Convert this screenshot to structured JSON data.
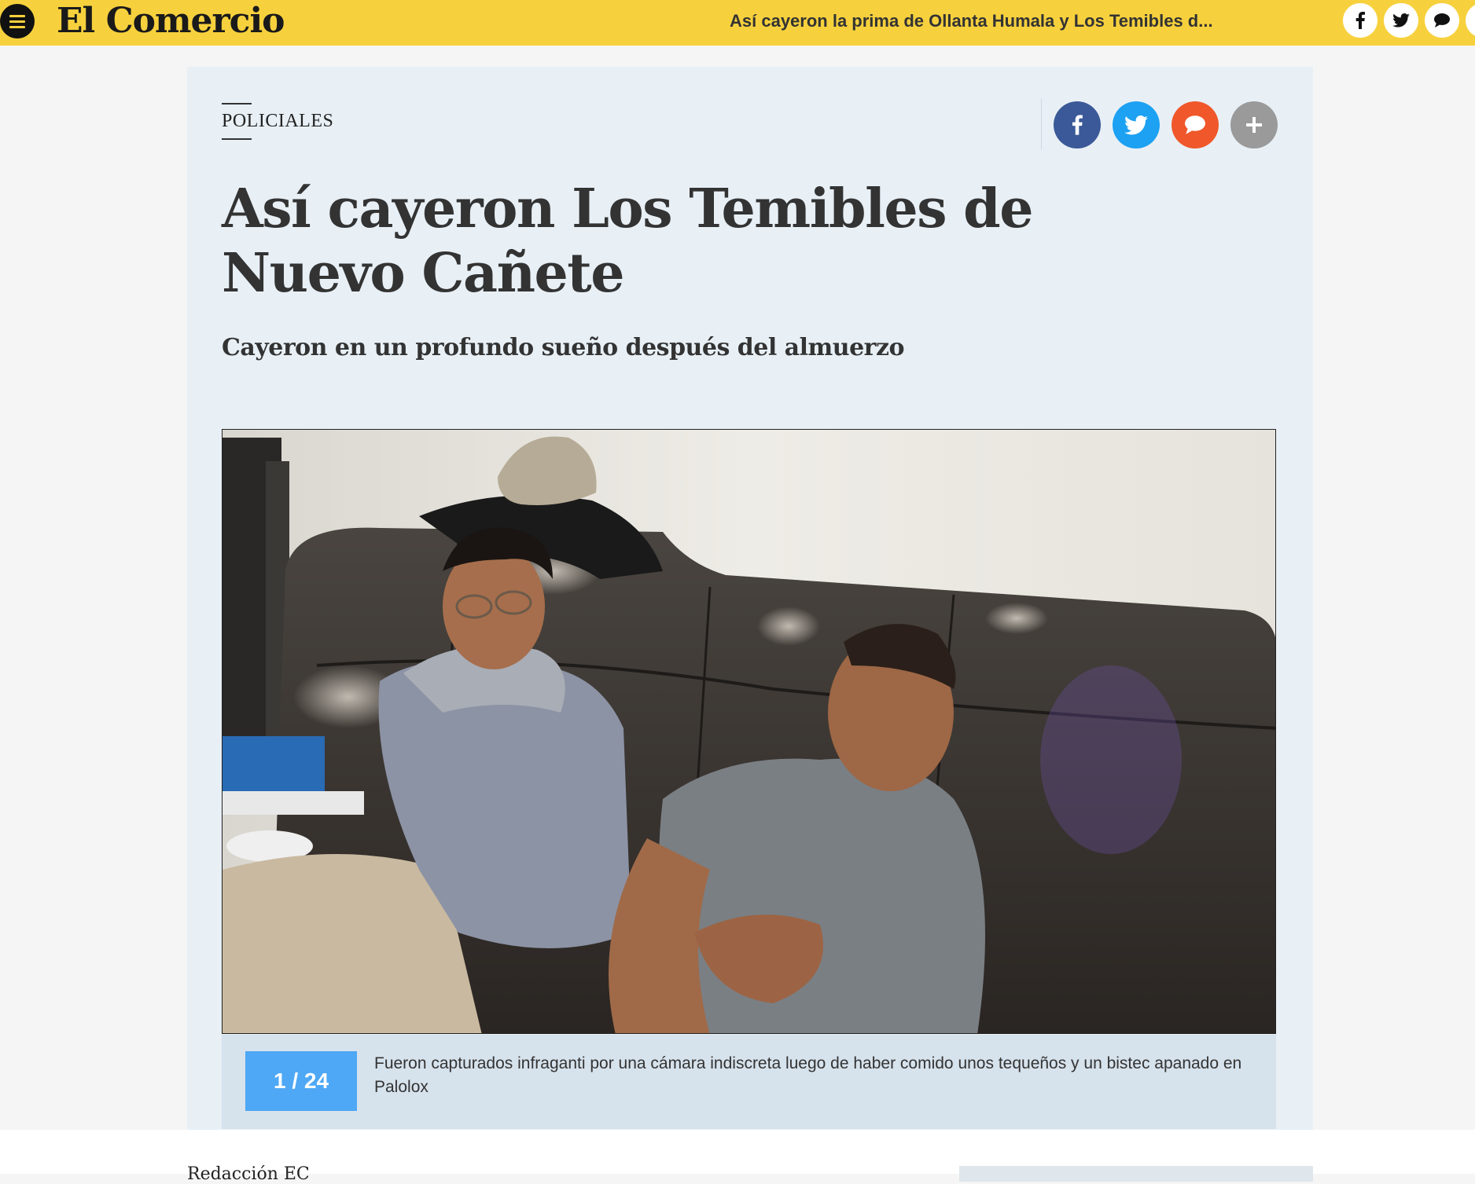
{
  "topbar": {
    "logo": "El Comercio",
    "headline": "Así cayeron la prima de Ollanta Humala y Los Temibles d...",
    "share": [
      {
        "name": "facebook-icon",
        "glyph": "f"
      },
      {
        "name": "twitter-icon",
        "glyph": "t"
      },
      {
        "name": "comment-icon",
        "glyph": "c"
      }
    ]
  },
  "article": {
    "section": "POLICIALES",
    "title": "Así cayeron Los Temibles de Nuevo Cañete",
    "subtitle": "Cayeron en un profundo sueño después del almuerzo"
  },
  "share_buttons": [
    {
      "name": "facebook",
      "color": "#3b5998"
    },
    {
      "name": "twitter",
      "color": "#1da1f2"
    },
    {
      "name": "comments",
      "color": "#f0572a"
    },
    {
      "name": "more",
      "color": "#9a9a9a"
    }
  ],
  "gallery": {
    "counter": "1 / 24",
    "caption": "Fueron capturados infraganti por una cámara indiscreta luego de haber comido unos tequeños y un bistec apanado en Palolox"
  },
  "footer": {
    "author": "Redacción EC"
  },
  "colors": {
    "brand_yellow": "#f7d13d",
    "card_bg": "#e8f0f6",
    "counter_blue": "#4ea8f5"
  }
}
